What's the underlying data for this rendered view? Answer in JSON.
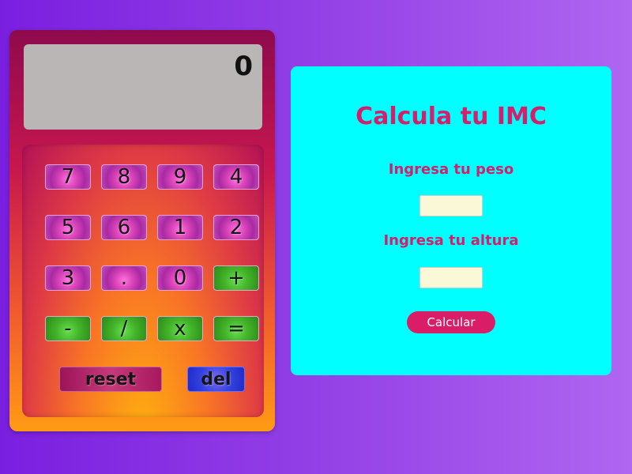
{
  "calculator": {
    "display": "0",
    "keys": [
      "7",
      "8",
      "9",
      "4",
      "5",
      "6",
      "1",
      "2",
      "3",
      ".",
      "0",
      "+",
      "-",
      "/",
      "x",
      "="
    ],
    "reset_label": "reset",
    "del_label": "del"
  },
  "imc": {
    "title": "Calcula tu IMC",
    "weight_label": "Ingresa tu peso",
    "height_label": "Ingresa tu altura",
    "weight_value": "",
    "height_value": "",
    "button_label": "Calcular"
  },
  "colors": {
    "accent": "#da1d67",
    "card_bg": "#00ffff",
    "display_bg": "#bbb6b6"
  }
}
